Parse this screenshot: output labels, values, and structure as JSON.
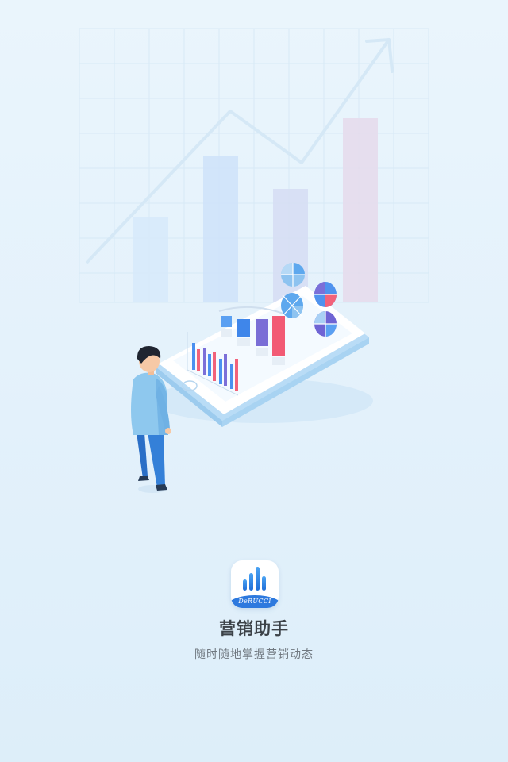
{
  "splash": {
    "app_name": "营销助手",
    "tagline": "随时随地掌握营销动态",
    "brand_mark": "DeRUCCI",
    "icon_name": "derucci-app-icon"
  },
  "illustration": {
    "background_bars": [
      {
        "value": 0.42,
        "color": "#d7eafb"
      },
      {
        "value": 0.72,
        "color": "#cfe3fa"
      },
      {
        "value": 0.56,
        "color": "#d6def4"
      },
      {
        "value": 0.91,
        "color": "#e6dcec"
      }
    ],
    "colors": {
      "accent_blue": "#4a90f0",
      "accent_red": "#f2627a",
      "accent_purple": "#7b6fd8",
      "person_shirt": "#8ec8ee",
      "person_pants": "#2f78d0",
      "phone_edge": "#bfe0f8"
    }
  }
}
